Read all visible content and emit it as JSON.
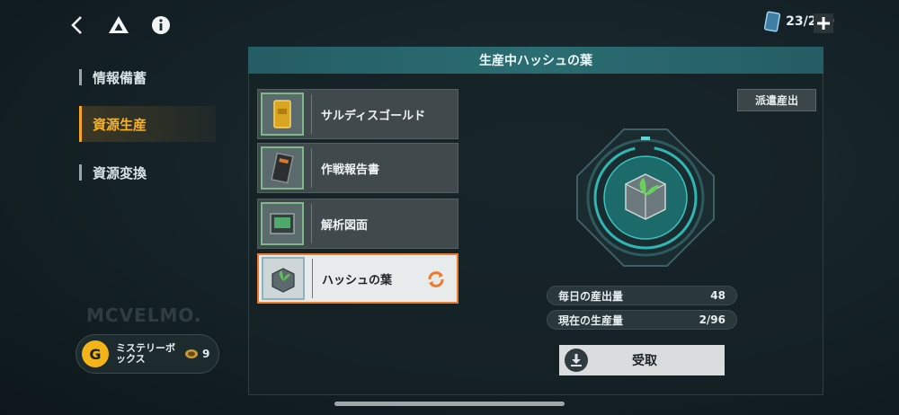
{
  "topbar": {
    "back_icon": "chevron-left-icon",
    "drive_icon": "triangle-logo-icon",
    "info_icon": "info-icon",
    "currency_value": "23/240",
    "add_icon": "plus-icon"
  },
  "nav": {
    "items": [
      {
        "label": "情報備蓄",
        "active": false
      },
      {
        "label": "資源生産",
        "active": true
      },
      {
        "label": "資源変換",
        "active": false
      }
    ]
  },
  "brand": "MCVELMO.",
  "mystery_box": {
    "label": "ミステリーボックス",
    "count": "9"
  },
  "panel": {
    "title": "生産中ハッシュの葉",
    "dispatch_label": "派遣産出",
    "items": [
      {
        "name": "サルディスゴールド",
        "icon": "gold-bar-icon"
      },
      {
        "name": "作戦報告書",
        "icon": "report-book-icon"
      },
      {
        "name": "解析図面",
        "icon": "blueprint-icon"
      },
      {
        "name": "ハッシュの葉",
        "icon": "plant-cube-icon"
      }
    ],
    "stats": [
      {
        "label": "毎日の産出量",
        "value": "48"
      },
      {
        "label": "現在の生産量",
        "value": "2/96"
      }
    ],
    "claim_label": "受取"
  },
  "colors": {
    "accent": "#f7a623",
    "header": "#2a6d72",
    "selected_border": "#f07a2c"
  }
}
